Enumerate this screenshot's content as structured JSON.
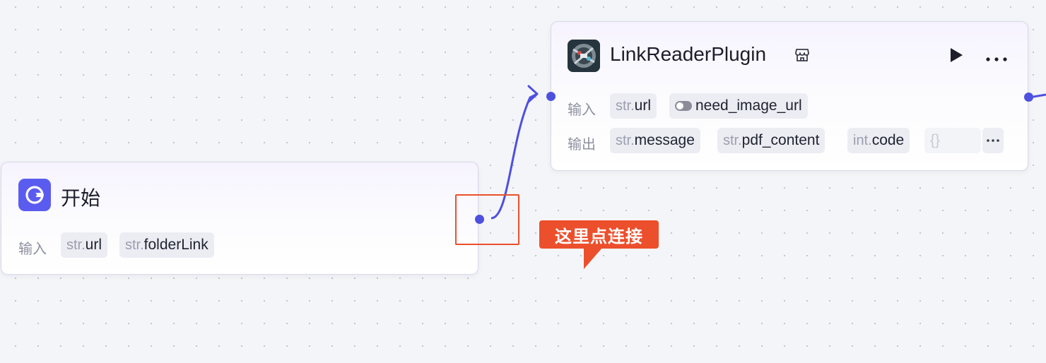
{
  "start_node": {
    "title": "开始",
    "input_label": "输入",
    "inputs": [
      {
        "type": "str.",
        "name": "url"
      },
      {
        "type": "str.",
        "name": "folderLink"
      }
    ]
  },
  "plugin_node": {
    "title": "LinkReaderPlugin",
    "input_label": "输入",
    "output_label": "输出",
    "inputs": [
      {
        "type": "str.",
        "name": "url"
      },
      {
        "type": "",
        "name": "need_image_url"
      }
    ],
    "outputs": [
      {
        "type": "str.",
        "name": "message"
      },
      {
        "type": "str.",
        "name": "pdf_content"
      },
      {
        "type": "int.",
        "name": "code"
      },
      {
        "type": "",
        "name": "{}"
      }
    ]
  },
  "callout": {
    "text": "这里点连接"
  },
  "colors": {
    "accent": "#4e50e0",
    "callout": "#ec4f2c",
    "start_icon_bg": "#5a5cf0"
  },
  "icons": {
    "start": "start-icon",
    "plugin": "plugin-avatar-icon",
    "store": "store-icon",
    "play": "play-icon",
    "more": "more-icon",
    "toggle": "toggle-icon"
  }
}
